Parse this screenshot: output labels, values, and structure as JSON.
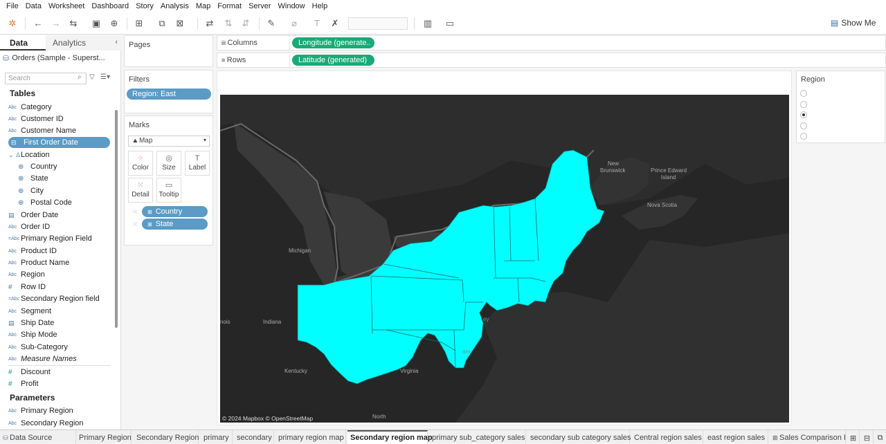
{
  "menu": [
    "File",
    "Data",
    "Worksheet",
    "Dashboard",
    "Story",
    "Analysis",
    "Map",
    "Format",
    "Server",
    "Window",
    "Help"
  ],
  "toolbar": {
    "show_me": "Show Me"
  },
  "data_pane": {
    "tab_data": "Data",
    "tab_analytics": "Analytics",
    "datasource": "Orders (Sample - Superst...",
    "search_placeholder": "Search",
    "tables_heading": "Tables",
    "fields": [
      {
        "label": "Category",
        "type": "Abc"
      },
      {
        "label": "Customer ID",
        "type": "Abc"
      },
      {
        "label": "Customer Name",
        "type": "Abc"
      },
      {
        "label": "First Order Date",
        "type": "date"
      },
      {
        "label": "Location",
        "type": "hierarchy"
      },
      {
        "label": "Country",
        "type": "geo"
      },
      {
        "label": "State",
        "type": "geo"
      },
      {
        "label": "City",
        "type": "geo"
      },
      {
        "label": "Postal Code",
        "type": "geo"
      },
      {
        "label": "Order Date",
        "type": "date"
      },
      {
        "label": "Order ID",
        "type": "Abc"
      },
      {
        "label": "Primary Region Field",
        "type": "Abc"
      },
      {
        "label": "Product ID",
        "type": "Abc"
      },
      {
        "label": "Product Name",
        "type": "Abc"
      },
      {
        "label": "Region",
        "type": "Abc"
      },
      {
        "label": "Row ID",
        "type": "#"
      },
      {
        "label": "Secondary Region field",
        "type": "Abc"
      },
      {
        "label": "Segment",
        "type": "Abc"
      },
      {
        "label": "Ship Date",
        "type": "date"
      },
      {
        "label": "Ship Mode",
        "type": "Abc"
      },
      {
        "label": "Sub-Category",
        "type": "Abc"
      },
      {
        "label": "Measure Names",
        "type": "Abc"
      },
      {
        "label": "Discount",
        "type": "#"
      },
      {
        "label": "Profit",
        "type": "#"
      }
    ],
    "parameters_heading": "Parameters",
    "parameters": [
      "Primary Region",
      "Secondary Region"
    ]
  },
  "pages": {
    "title": "Pages"
  },
  "filters": {
    "title": "Filters",
    "pill": "Region: East"
  },
  "marks": {
    "title": "Marks",
    "type": "Map",
    "buttons": [
      "Color",
      "Size",
      "Label",
      "Detail",
      "Tooltip"
    ],
    "pills": [
      "Country",
      "State"
    ]
  },
  "columns": {
    "label": "Columns",
    "pill": "Longitude (generate.."
  },
  "rows": {
    "label": "Rows",
    "pill": "Latitude (generated)"
  },
  "map": {
    "attribution": "© 2024 Mapbox © OpenStreetMap",
    "labels": [
      "New Brunswick",
      "Prince Edward Island",
      "Nova Scotia",
      "Michigan",
      "Indiana",
      "Kentucky",
      "Virginia",
      "North",
      "nois",
      "ey",
      "are"
    ],
    "highlight_color": "#00ffff",
    "background_color": "#262626"
  },
  "legend": {
    "title": "Region",
    "options_count": 5,
    "selected_index": 2
  },
  "tabs": [
    "Data Source",
    "Primary Region",
    "Secondary Region",
    "primary",
    "secondary",
    "primary region map",
    "Secondary region map",
    "primary sub_category sales",
    "secondary sub category sales",
    "Central region sales",
    "east region sales",
    "Sales Comparison By"
  ],
  "active_tab": "Secondary region map"
}
